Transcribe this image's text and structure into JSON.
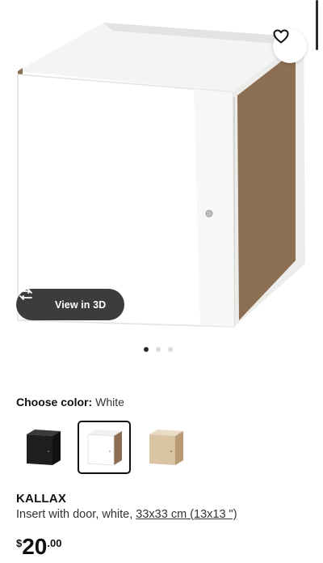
{
  "product": {
    "name": "KALLAX",
    "description": "Insert with door, white, ",
    "size_link": "33x33 cm (13x13 \")",
    "price_currency": "$",
    "price_integer": "20",
    "price_decimal": ".00"
  },
  "gallery": {
    "view_3d_label": "View in 3D",
    "image_count": 3,
    "active_index": 0
  },
  "color_picker": {
    "label": "Choose color:",
    "selected": "White",
    "options": [
      {
        "name": "black-brown",
        "color": "#1e1e1e"
      },
      {
        "name": "white",
        "color": "#ffffff"
      },
      {
        "name": "white stained oak effect",
        "color": "#d9c4a3"
      }
    ]
  },
  "colors": {
    "wood": "#8c6e52",
    "button_dark": "#3c3c3c",
    "text": "#111111"
  },
  "icons": {
    "favorite": "heart-icon",
    "view_3d": "rotate-3d-icon"
  }
}
